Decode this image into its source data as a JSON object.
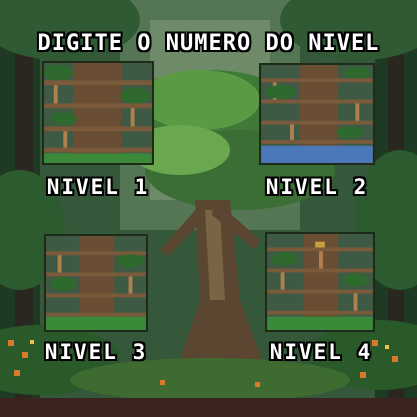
{
  "title": "DIGITE O NUMERO DO NIVEL",
  "levels": [
    {
      "label": "NIVEL 1"
    },
    {
      "label": "NIVEL 2"
    },
    {
      "label": "NIVEL 3"
    },
    {
      "label": "NIVEL 4"
    }
  ],
  "colors": {
    "sky": "#2d4a2a",
    "foliage_dark": "#1f3a22",
    "foliage_light": "#4f8a3c",
    "trunk": "#5a4631",
    "ground": "#3b2420",
    "flowers": "#d9792a",
    "text": "#ffffff"
  }
}
